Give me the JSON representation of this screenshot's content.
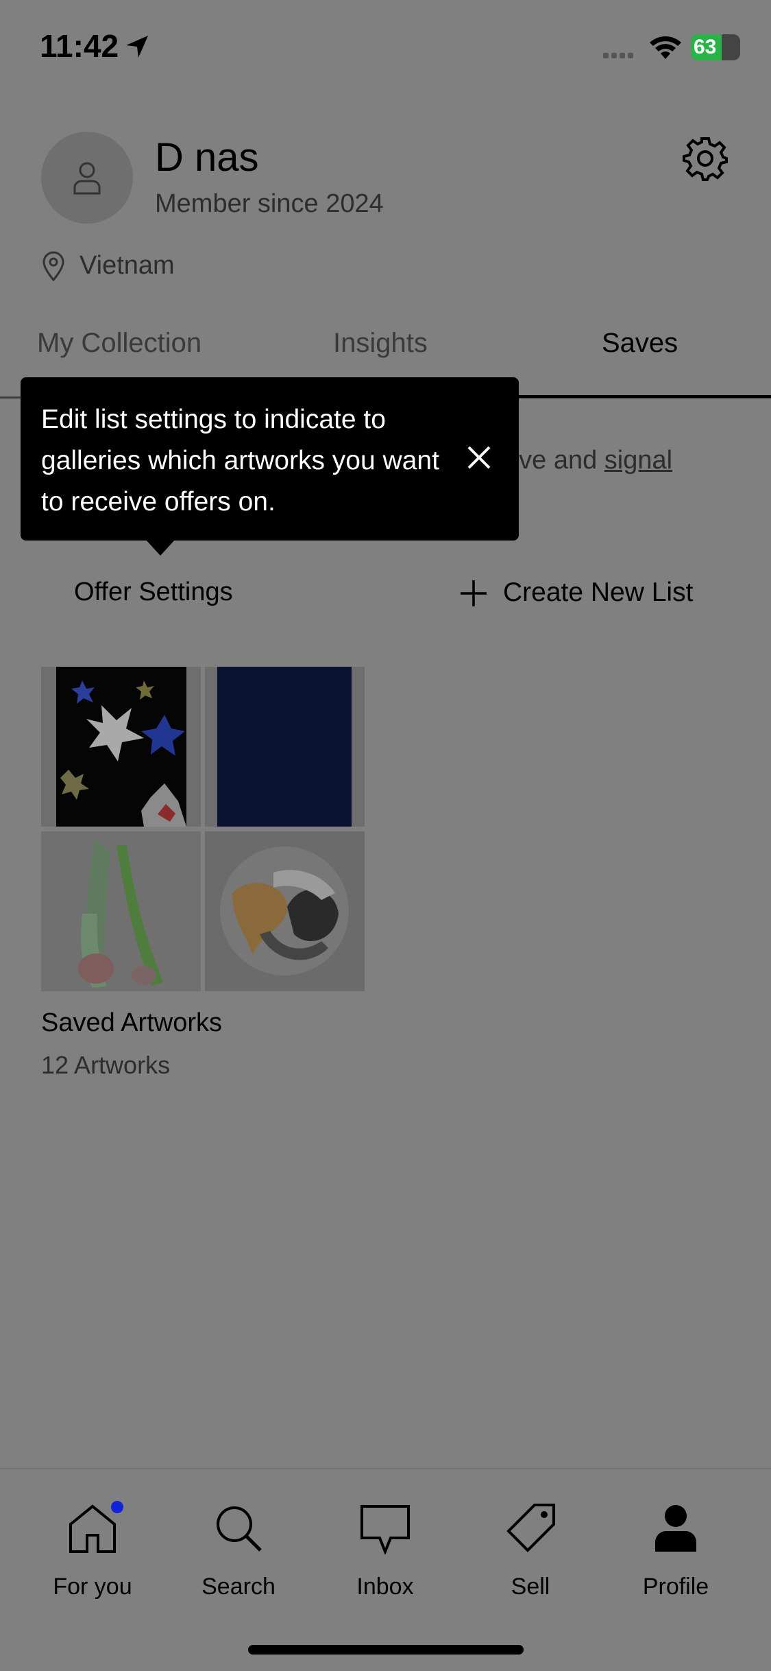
{
  "status_bar": {
    "time": "11:42",
    "battery": "63"
  },
  "profile": {
    "name": "D nas",
    "member_since": "Member since 2024",
    "location": "Vietnam"
  },
  "tabs": [
    {
      "label": "My Collection"
    },
    {
      "label": "Insights"
    },
    {
      "label": "Saves"
    }
  ],
  "saves": {
    "description_fragment": "ove and ",
    "description_link": "signal"
  },
  "tooltip": {
    "text": "Edit list settings to indicate to galleries which artworks you want to receive offers on."
  },
  "actions": {
    "offer_settings": "Offer Settings",
    "create_new_list": "Create New List"
  },
  "list": {
    "title": "Saved Artworks",
    "count": "12 Artworks"
  },
  "nav": [
    {
      "label": "For you",
      "icon": "home-icon"
    },
    {
      "label": "Search",
      "icon": "search-icon"
    },
    {
      "label": "Inbox",
      "icon": "inbox-icon"
    },
    {
      "label": "Sell",
      "icon": "tag-icon"
    },
    {
      "label": "Profile",
      "icon": "profile-icon"
    }
  ],
  "colors": {
    "overlay": "#808080",
    "notification_dot": "#1023d7",
    "tooltip_bg": "#000000"
  }
}
